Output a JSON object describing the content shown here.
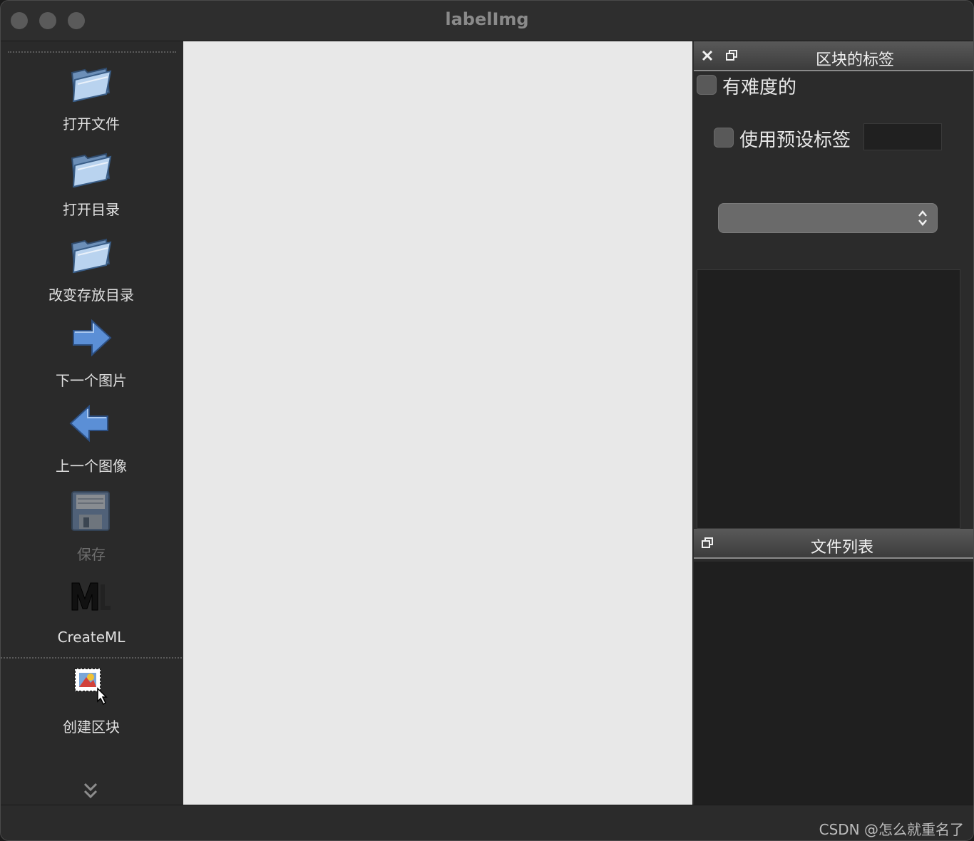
{
  "window": {
    "title": "labelImg"
  },
  "toolbar": {
    "tools": [
      {
        "id": "open-file",
        "label": "打开文件",
        "icon": "open-folder-icon",
        "enabled": true
      },
      {
        "id": "open-dir",
        "label": "打开目录",
        "icon": "open-folder-icon",
        "enabled": true
      },
      {
        "id": "change-save-dir",
        "label": "改变存放目录",
        "icon": "open-folder-icon",
        "enabled": true
      },
      {
        "id": "next-image",
        "label": "下一个图片",
        "icon": "arrow-right-icon",
        "enabled": true
      },
      {
        "id": "prev-image",
        "label": "上一个图像",
        "icon": "arrow-left-icon",
        "enabled": true
      },
      {
        "id": "save",
        "label": "保存",
        "icon": "floppy-disk-icon",
        "enabled": false
      },
      {
        "id": "create-ml",
        "label": "CreateML",
        "icon": "createml-format-icon",
        "enabled": true
      },
      {
        "id": "create-box",
        "label": "创建区块",
        "icon": "create-rectbox-icon",
        "enabled": true
      }
    ],
    "expander_icon": "chevron-double-down-icon"
  },
  "dock": {
    "labels_panel": {
      "title": "区块的标签",
      "difficult_label": "有难度的",
      "use_default_label": "使用预设标签",
      "default_label_value": "",
      "combo_value": ""
    },
    "file_list_panel": {
      "title": "文件列表"
    }
  },
  "watermark": "CSDN @怎么就重名了",
  "colors": {
    "window_bg": "#2b2b2b",
    "canvas_bg": "#e8e8e8",
    "list_bg": "#1f1f1f",
    "folder_blue": "#8fb6e0",
    "arrow_blue": "#4f86d0"
  }
}
